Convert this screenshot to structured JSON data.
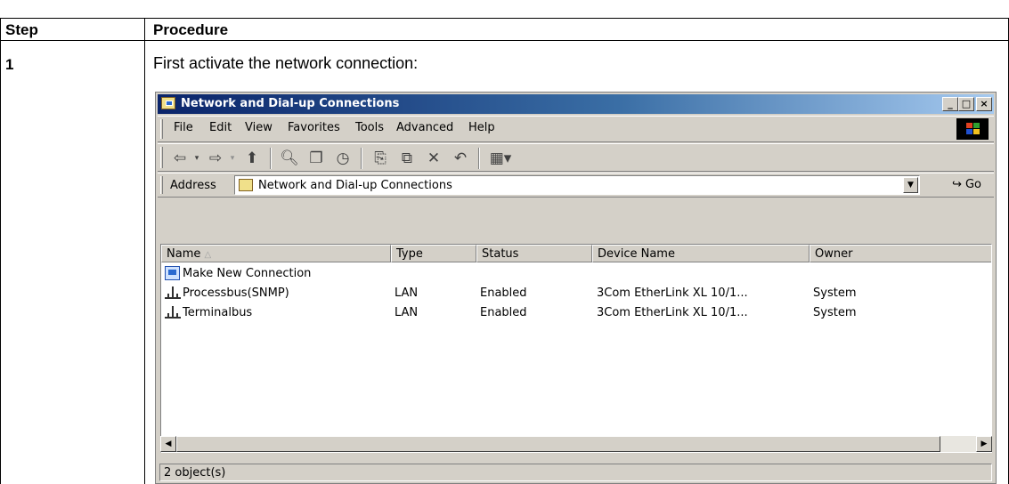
{
  "table": {
    "header_step": "Step",
    "header_procedure": "Procedure",
    "step_number": "1",
    "intro_text": "First activate the network connection:"
  },
  "window": {
    "title": "Network and Dial-up Connections",
    "controls": [
      "_",
      "□",
      "×"
    ],
    "menu": [
      "File",
      "Edit",
      "View",
      "Favorites",
      "Tools",
      "Advanced",
      "Help"
    ],
    "toolbar_icons": [
      "back-icon",
      "forward-icon",
      "up-folder-icon",
      "search-icon",
      "folders-icon",
      "history-icon",
      "move-to-icon",
      "copy-to-icon",
      "delete-icon",
      "undo-icon",
      "views-icon"
    ],
    "address": {
      "label": "Address",
      "value": "Network and Dial-up Connections",
      "go_label": "Go"
    },
    "columns": [
      "Name",
      "Type",
      "Status",
      "Device Name",
      "Owner"
    ],
    "rows": [
      {
        "name": "Make New Connection",
        "type": "",
        "status": "",
        "device": "",
        "owner": "",
        "icon": "make-new-connection-icon"
      },
      {
        "name": "Processbus(SNMP)",
        "type": "LAN",
        "status": "Enabled",
        "device": "3Com EtherLink XL 10/1...",
        "owner": "System",
        "icon": "lan-connection-icon"
      },
      {
        "name": "Terminalbus",
        "type": "LAN",
        "status": "Enabled",
        "device": "3Com EtherLink XL 10/1...",
        "owner": "System",
        "icon": "lan-connection-icon"
      }
    ],
    "status_text": "2 object(s)"
  },
  "colors": {
    "title_gradient_start": "#0a246a",
    "title_gradient_end": "#a6caf0",
    "window_face": "#d4d0c8"
  }
}
